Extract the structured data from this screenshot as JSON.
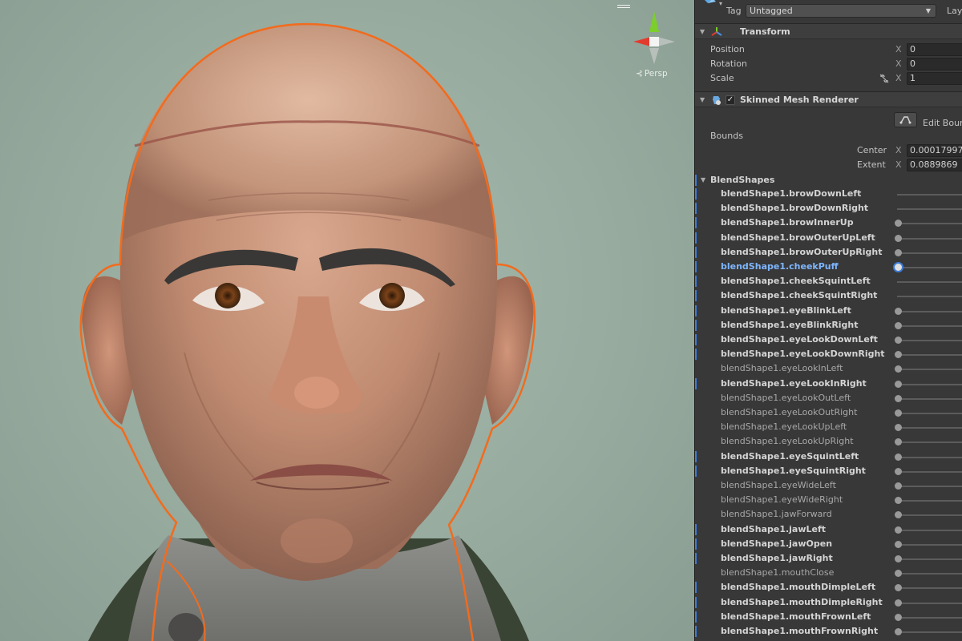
{
  "inspector": {
    "tag": {
      "label": "Tag",
      "value": "Untagged"
    },
    "layer_label": "Lay",
    "transform": {
      "title": "Transform",
      "rows": [
        {
          "label": "Position",
          "axis": "X",
          "value": "0"
        },
        {
          "label": "Rotation",
          "axis": "X",
          "value": "0"
        },
        {
          "label": "Scale",
          "axis": "X",
          "value": "1"
        }
      ]
    },
    "skinned_mesh": {
      "title": "Skinned Mesh Renderer",
      "enabled_mark": "✓",
      "edit_bounds_label": "Edit Boun",
      "bounds_label": "Bounds",
      "center": {
        "label": "Center",
        "axis": "X",
        "value": "0.00017997"
      },
      "extent": {
        "label": "Extent",
        "axis": "X",
        "value": "0.0889869"
      }
    },
    "blendshapes": {
      "title": "BlendShapes",
      "items": [
        {
          "name": "blendShape1.browDownLeft",
          "style": "bold",
          "knob": false,
          "bar": true
        },
        {
          "name": "blendShape1.browDownRight",
          "style": "bold",
          "knob": false,
          "bar": true
        },
        {
          "name": "blendShape1.browInnerUp",
          "style": "bold",
          "knob": true,
          "bar": true
        },
        {
          "name": "blendShape1.browOuterUpLeft",
          "style": "bold",
          "knob": true,
          "bar": true
        },
        {
          "name": "blendShape1.browOuterUpRight",
          "style": "bold",
          "knob": true,
          "bar": true
        },
        {
          "name": "blendShape1.cheekPuff",
          "style": "active",
          "knob": true,
          "bar": true
        },
        {
          "name": "blendShape1.cheekSquintLeft",
          "style": "bold",
          "knob": false,
          "bar": true
        },
        {
          "name": "blendShape1.cheekSquintRight",
          "style": "bold",
          "knob": false,
          "bar": true
        },
        {
          "name": "blendShape1.eyeBlinkLeft",
          "style": "bold",
          "knob": true,
          "bar": true
        },
        {
          "name": "blendShape1.eyeBlinkRight",
          "style": "bold",
          "knob": true,
          "bar": true
        },
        {
          "name": "blendShape1.eyeLookDownLeft",
          "style": "bold",
          "knob": true,
          "bar": true
        },
        {
          "name": "blendShape1.eyeLookDownRight",
          "style": "bold",
          "knob": true,
          "bar": true
        },
        {
          "name": "blendShape1.eyeLookInLeft",
          "style": "light",
          "knob": true,
          "bar": false
        },
        {
          "name": "blendShape1.eyeLookInRight",
          "style": "bold",
          "knob": true,
          "bar": true
        },
        {
          "name": "blendShape1.eyeLookOutLeft",
          "style": "light",
          "knob": true,
          "bar": false
        },
        {
          "name": "blendShape1.eyeLookOutRight",
          "style": "light",
          "knob": true,
          "bar": false
        },
        {
          "name": "blendShape1.eyeLookUpLeft",
          "style": "light",
          "knob": true,
          "bar": false
        },
        {
          "name": "blendShape1.eyeLookUpRight",
          "style": "light",
          "knob": true,
          "bar": false
        },
        {
          "name": "blendShape1.eyeSquintLeft",
          "style": "bold",
          "knob": true,
          "bar": true
        },
        {
          "name": "blendShape1.eyeSquintRight",
          "style": "bold",
          "knob": true,
          "bar": true
        },
        {
          "name": "blendShape1.eyeWideLeft",
          "style": "light",
          "knob": true,
          "bar": false
        },
        {
          "name": "blendShape1.eyeWideRight",
          "style": "light",
          "knob": true,
          "bar": false
        },
        {
          "name": "blendShape1.jawForward",
          "style": "light",
          "knob": true,
          "bar": false
        },
        {
          "name": "blendShape1.jawLeft",
          "style": "bold",
          "knob": true,
          "bar": true
        },
        {
          "name": "blendShape1.jawOpen",
          "style": "bold",
          "knob": true,
          "bar": true
        },
        {
          "name": "blendShape1.jawRight",
          "style": "bold",
          "knob": true,
          "bar": true
        },
        {
          "name": "blendShape1.mouthClose",
          "style": "light",
          "knob": true,
          "bar": false
        },
        {
          "name": "blendShape1.mouthDimpleLeft",
          "style": "bold",
          "knob": true,
          "bar": true
        },
        {
          "name": "blendShape1.mouthDimpleRight",
          "style": "bold",
          "knob": true,
          "bar": true
        },
        {
          "name": "blendShape1.mouthFrownLeft",
          "style": "bold",
          "knob": true,
          "bar": true
        },
        {
          "name": "blendShape1.mouthFrownRight",
          "style": "bold",
          "knob": true,
          "bar": true
        }
      ]
    }
  },
  "scene": {
    "persp_label": "Persp",
    "selection_outline_color": "#f26b1d",
    "gizmo_colors": {
      "x": "#e23b2e",
      "y": "#7ccf2b",
      "z": "#4a8fe2"
    }
  }
}
